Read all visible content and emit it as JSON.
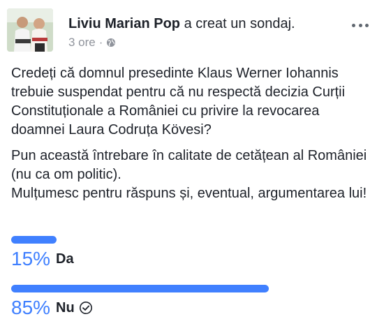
{
  "post": {
    "author": "Liviu Marian Pop",
    "action": "a creat un sondaj.",
    "time": "3 ore",
    "separator": "·",
    "privacy_icon": "globe-icon",
    "more_icon": "more-options-icon"
  },
  "poll": {
    "question": "Credeți că domnul presedinte Klaus Werner Iohannis trebuie suspendat pentru că nu respectă decizia Curții Constituționale a României cu privire la revocarea doamnei Laura Codruța Kövesi?",
    "note_line1": "Pun această întrebare în calitate de cetățean al României (nu ca om politic).",
    "note_line2": "Mulțumesc pentru răspuns și, eventual, argumentarea lui!",
    "options": [
      {
        "label": "Da",
        "percent": 15,
        "percent_text": "15%",
        "selected": false
      },
      {
        "label": "Nu",
        "percent": 85,
        "percent_text": "85%",
        "selected": true
      }
    ],
    "accent_color": "#4080ff"
  }
}
